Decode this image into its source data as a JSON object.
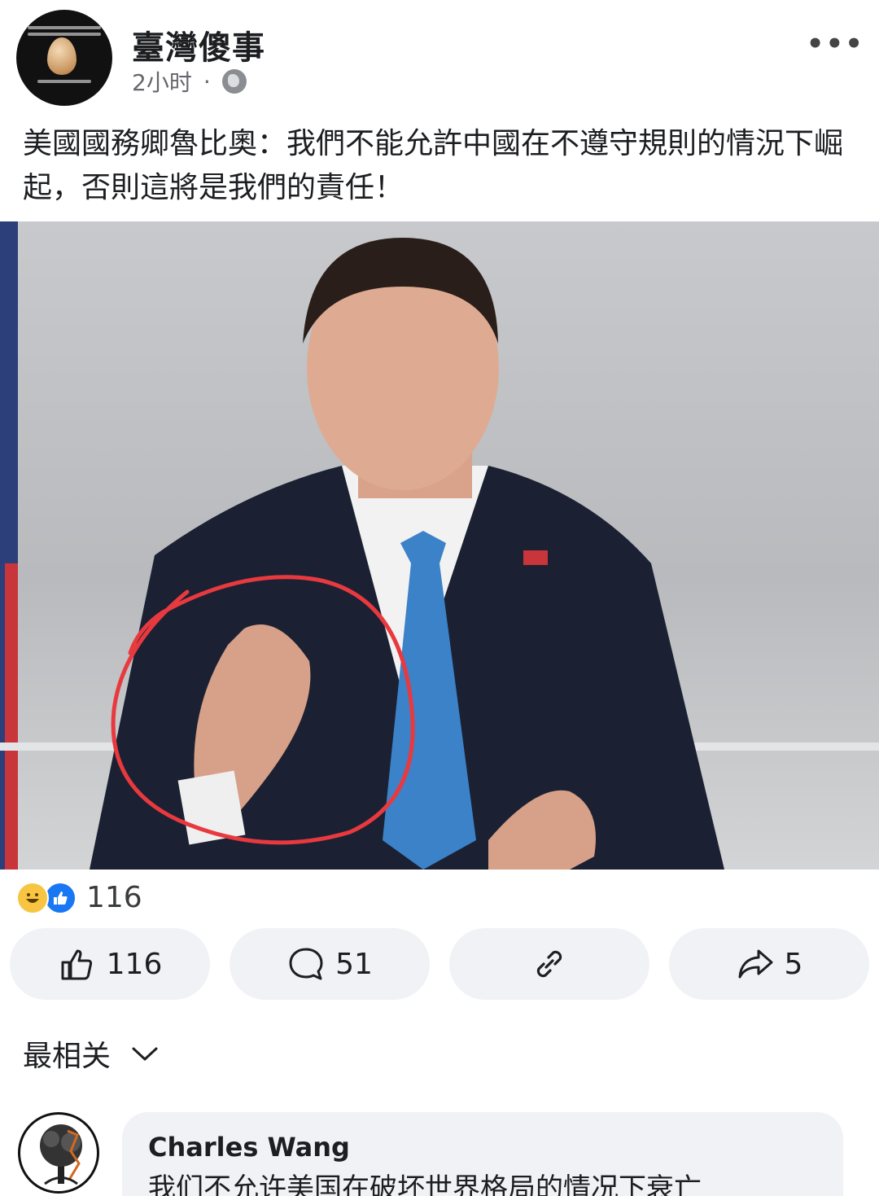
{
  "post": {
    "page_name": "臺灣傻事",
    "time": "2小时",
    "separator": "·",
    "privacy_icon": "globe-icon",
    "more_icon": "more-options-icon",
    "text": "美國國務卿魯比奧：我們不能允許中國在不遵守規則的情況下崛起，否則這將是我們的責任！"
  },
  "reactions": {
    "icons": [
      "haha-emoji-icon",
      "like-emoji-icon"
    ],
    "count": "116"
  },
  "actions": {
    "like": "116",
    "comment": "51",
    "share": "5"
  },
  "sort": {
    "label": "最相关"
  },
  "comment": {
    "author": "Charles Wang",
    "text": "我们不允许美国在破坏世界格局的情况下衰亡"
  },
  "colors": {
    "accent": "#1877f2",
    "circle": "#e8393f",
    "tie": "#3b82c8"
  }
}
